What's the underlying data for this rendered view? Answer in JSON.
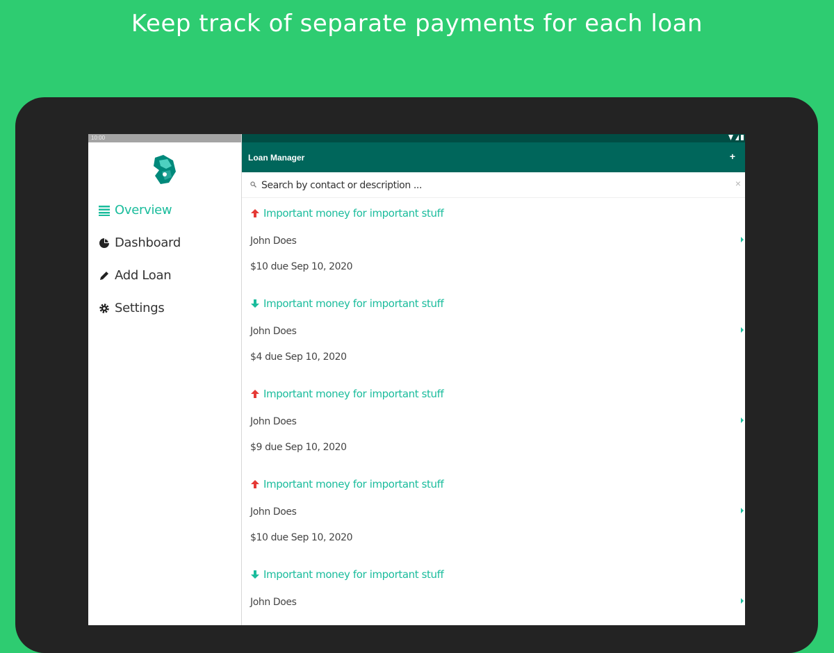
{
  "headline": "Keep track of separate payments for each loan",
  "status_time": "10:00",
  "drawer": {
    "items": [
      {
        "label": "Overview",
        "icon": "list-icon",
        "active": true
      },
      {
        "label": "Dashboard",
        "icon": "pie-chart-icon",
        "active": false
      },
      {
        "label": "Add Loan",
        "icon": "pencil-icon",
        "active": false
      },
      {
        "label": "Settings",
        "icon": "gear-icon",
        "active": false
      }
    ]
  },
  "app_bar": {
    "title": "Loan Manager",
    "add_label": "+"
  },
  "search": {
    "placeholder": "Search by contact or description ...",
    "clear_label": "×"
  },
  "loans": [
    {
      "title": "Important money for important stuff",
      "direction": "up",
      "contact": "John Does",
      "due": "$10 due Sep 10, 2020"
    },
    {
      "title": "Important money for important stuff",
      "direction": "down",
      "contact": "John Does",
      "due": "$4 due Sep 10, 2020"
    },
    {
      "title": "Important money for important stuff",
      "direction": "up",
      "contact": "John Does",
      "due": "$9 due Sep 10, 2020"
    },
    {
      "title": "Important money for important stuff",
      "direction": "up",
      "contact": "John Does",
      "due": "$10 due Sep 10, 2020"
    },
    {
      "title": "Important money for important stuff",
      "direction": "down",
      "contact": "John Does",
      "due": ""
    }
  ],
  "colors": {
    "background": "#2ecc71",
    "tablet_frame": "#232323",
    "app_bar": "#00665b",
    "status_bar": "#004d44",
    "accent": "#1abc9c",
    "arrow_up": "#e53935",
    "arrow_down": "#1abc9c"
  }
}
